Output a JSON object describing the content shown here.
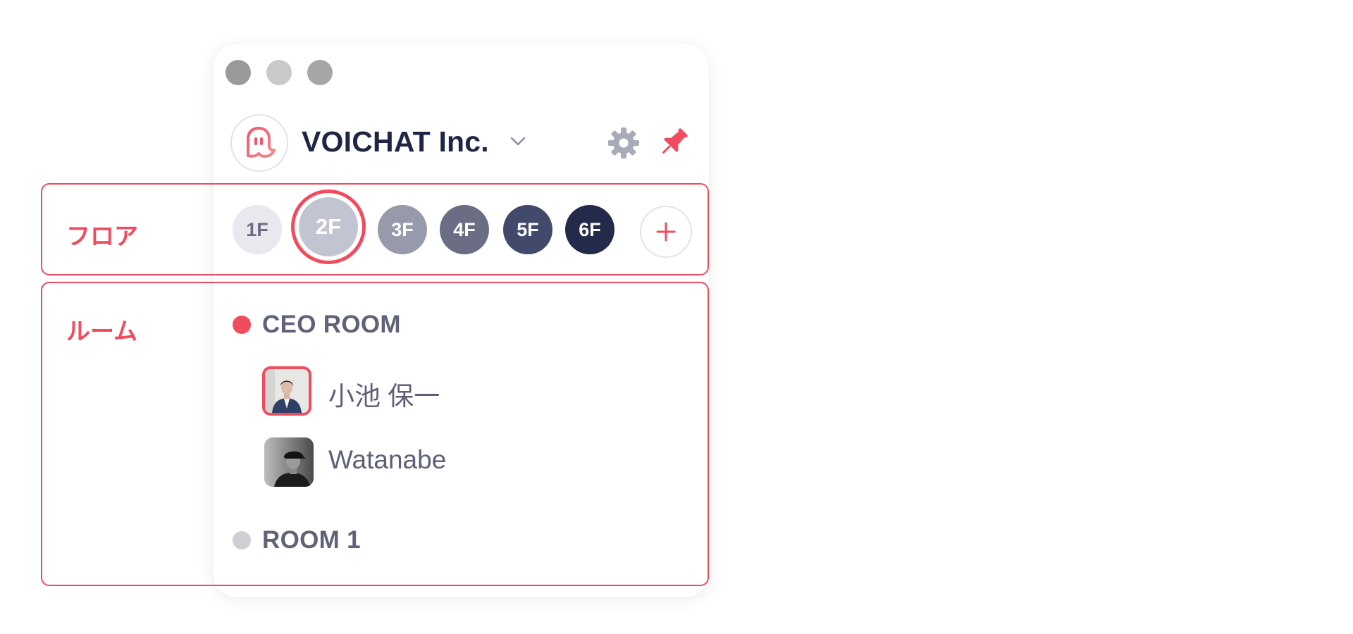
{
  "annotations": {
    "floor_label": "フロア",
    "room_label": "ルーム",
    "accent_color": "#f04c5e"
  },
  "window": {
    "workspace": {
      "name": "VOICHAT Inc.",
      "logo_icon": "voichat-ghost-logo-icon",
      "dropdown_icon": "chevron-down-icon"
    },
    "toolbar_icons": [
      "gear-icon",
      "pin-icon"
    ]
  },
  "floors": {
    "selected": "2F",
    "items": [
      {
        "label": "1F",
        "bg": "#e8e8ee",
        "fg": "#6b6e83"
      },
      {
        "label": "2F",
        "bg": "#c2c5d1",
        "fg": "#ffffff"
      },
      {
        "label": "3F",
        "bg": "#979aab",
        "fg": "#ffffff"
      },
      {
        "label": "4F",
        "bg": "#6a6d84",
        "fg": "#ffffff"
      },
      {
        "label": "5F",
        "bg": "#424a6c",
        "fg": "#ffffff"
      },
      {
        "label": "6F",
        "bg": "#232a4a",
        "fg": "#ffffff"
      }
    ],
    "add_icon": "plus-icon"
  },
  "rooms": [
    {
      "name": "CEO ROOM",
      "status_color": "#f04c5e",
      "members": [
        {
          "name": "小池 保一",
          "speaking": true
        },
        {
          "name": "Watanabe",
          "speaking": false
        }
      ]
    },
    {
      "name": "ROOM 1",
      "status_color": "#cfcfd3",
      "members": []
    }
  ]
}
